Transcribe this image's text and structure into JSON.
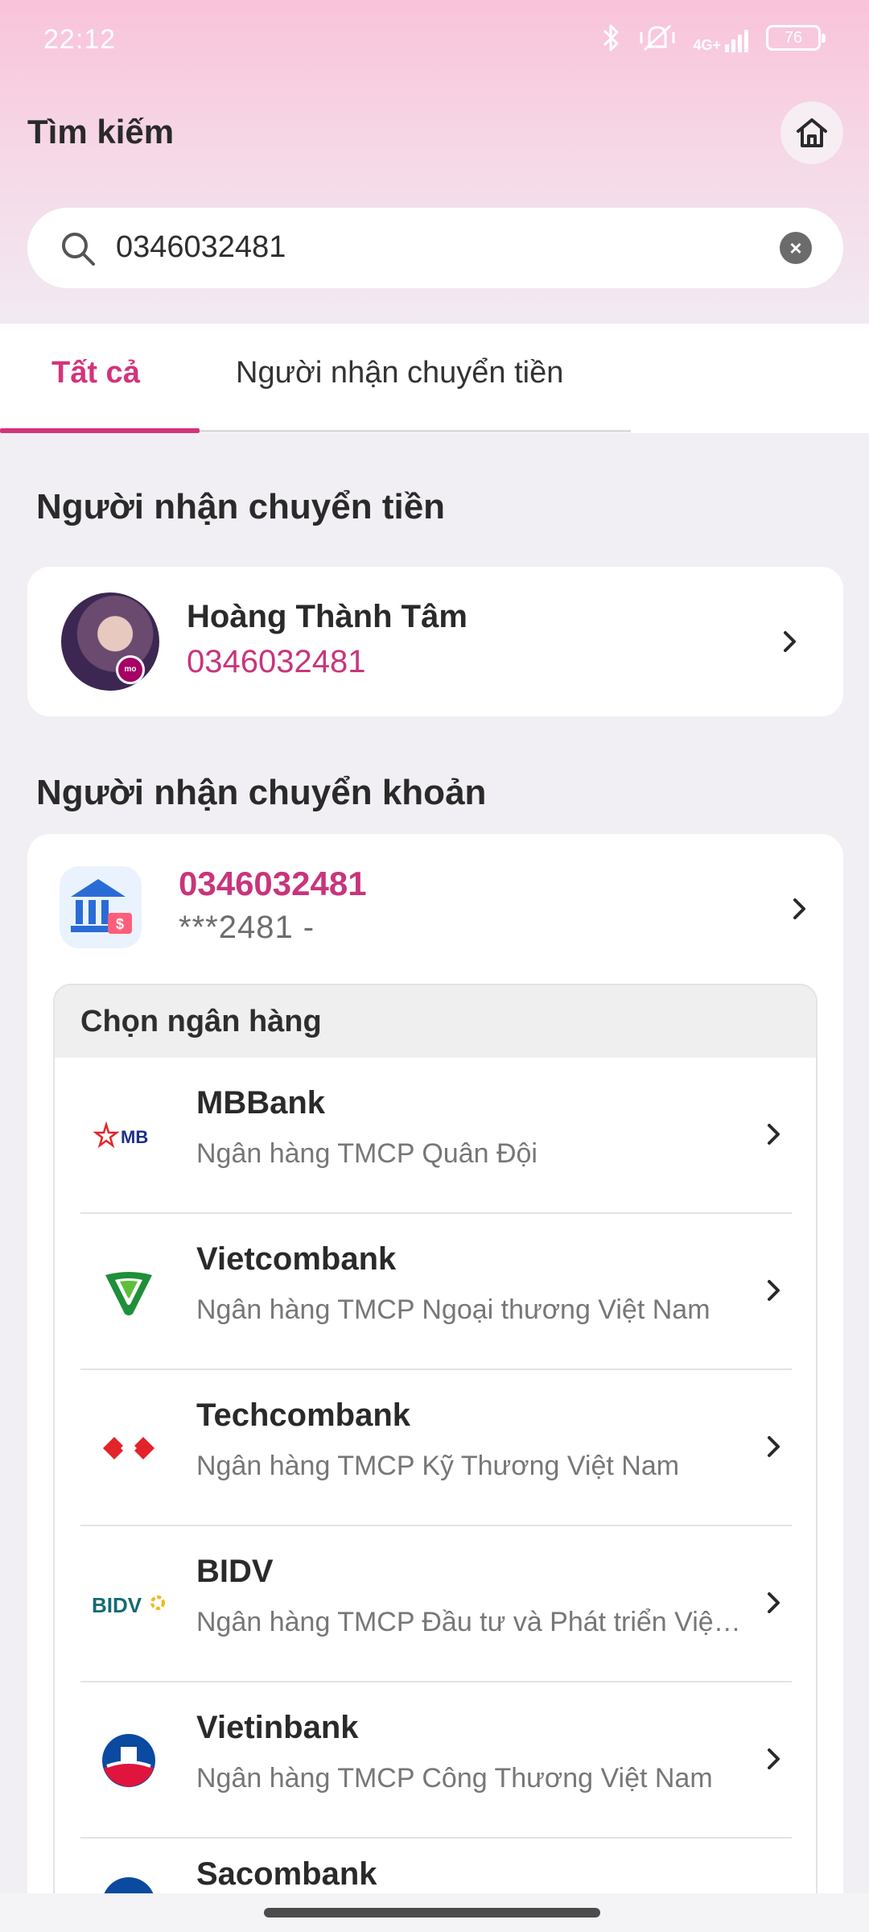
{
  "status_bar": {
    "time": "22:12",
    "network": "4G+",
    "battery": "76",
    "icons": [
      "bluetooth-icon",
      "mute-vibrate-icon",
      "signal-icon",
      "battery-icon"
    ]
  },
  "header": {
    "title": "Tìm kiếm",
    "home_icon": "home-icon"
  },
  "search": {
    "value": "0346032481",
    "clear_icon": "clear-icon",
    "clear_symbol": "×"
  },
  "tabs": [
    {
      "label": "Tất cả",
      "active": true
    },
    {
      "label": "Người nhận chuyển tiền",
      "active": false
    }
  ],
  "transfer_recipients": {
    "title": "Người nhận chuyển tiền",
    "contact": {
      "name": "Hoàng Thành Tâm",
      "phone": "0346032481"
    }
  },
  "bank_recipients": {
    "title": "Người nhận chuyển khoản",
    "account": {
      "number": "0346032481",
      "masked": "***2481 -"
    },
    "bank_selector": {
      "title": "Chọn ngân hàng",
      "banks": [
        {
          "name": "MBBank",
          "full_name": "Ngân hàng TMCP Quân Đội",
          "logo_text": "MB"
        },
        {
          "name": "Vietcombank",
          "full_name": "Ngân hàng TMCP Ngoại thương Việt Nam",
          "logo_text": ""
        },
        {
          "name": "Techcombank",
          "full_name": "Ngân hàng TMCP Kỹ Thương Việt Nam",
          "logo_text": ""
        },
        {
          "name": "BIDV",
          "full_name": "Ngân hàng TMCP Đầu tư và Phát triển Việt Nam",
          "logo_text": "BIDV"
        },
        {
          "name": "Vietinbank",
          "full_name": "Ngân hàng TMCP Công Thương Việt Nam",
          "logo_text": ""
        },
        {
          "name": "Sacombank",
          "full_name": "",
          "logo_text": ""
        }
      ]
    }
  },
  "colors": {
    "accent": "#d4337b",
    "phone_text": "#c8357c",
    "header_gradient_top": "#f9c3da",
    "background": "#f1eff4"
  }
}
